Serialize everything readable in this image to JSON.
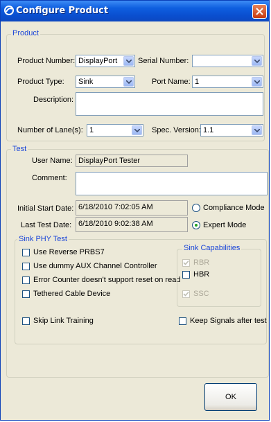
{
  "window": {
    "title": "Configure Product",
    "close_icon": "close-icon",
    "app_icon": "app-logo-icon"
  },
  "product": {
    "legend": "Product",
    "product_number_label": "Product Number:",
    "product_number_value": "DisplayPort",
    "serial_number_label": "Serial Number:",
    "serial_number_value": "",
    "product_type_label": "Product Type:",
    "product_type_value": "Sink",
    "port_name_label": "Port Name:",
    "port_name_value": "1",
    "description_label": "Description:",
    "description_value": "",
    "lanes_label": "Number of Lane(s):",
    "lanes_value": "1",
    "spec_label": "Spec. Version:",
    "spec_value": "1.1"
  },
  "test": {
    "legend": "Test",
    "user_name_label": "User Name:",
    "user_name_value": "DisplayPort Tester",
    "comment_label": "Comment:",
    "comment_value": "",
    "initial_start_label": "Initial Start Date:",
    "initial_start_value": "6/18/2010 7:02:05 AM",
    "last_test_label": "Last Test Date:",
    "last_test_value": "6/18/2010 9:02:38 AM",
    "mode_compliance": "Compliance Mode",
    "mode_expert": "Expert Mode",
    "selected_mode": "Expert Mode"
  },
  "sink_phy": {
    "legend": "Sink PHY Test",
    "options": [
      {
        "label": "Use Reverse PRBS7",
        "checked": false
      },
      {
        "label": "Use dummy AUX Channel Controller",
        "checked": false
      },
      {
        "label": "Error Counter doesn't support reset on read",
        "checked": false
      },
      {
        "label": "Tethered Cable Device",
        "checked": false
      }
    ],
    "skip_link_training": "Skip Link Training",
    "keep_signals": "Keep Signals after test"
  },
  "sink_caps": {
    "legend": "Sink Capabilities",
    "rbr": "RBR",
    "hbr": "HBR",
    "ssc": "SSC"
  },
  "buttons": {
    "ok": "OK"
  }
}
